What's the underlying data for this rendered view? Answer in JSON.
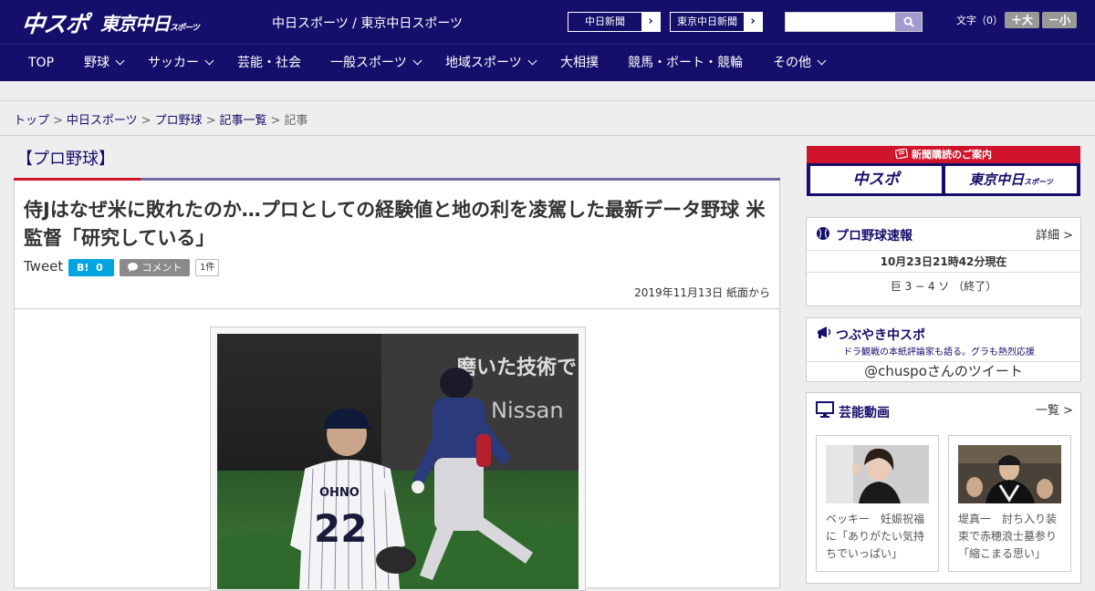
{
  "header": {
    "logo_main": "中スポ",
    "logo_tokyo": "東京中日",
    "logo_tokyo_suffix": "スポーツ",
    "site_name": "中日スポーツ / 東京中日スポーツ",
    "paper_links": [
      "中日新聞",
      "東京中日新聞"
    ],
    "search_placeholder": "",
    "font_size_label": "文字（0）",
    "font_bigger": "＋大",
    "font_smaller": "－小"
  },
  "nav": [
    {
      "label": "TOP",
      "has_menu": false
    },
    {
      "label": "野球",
      "has_menu": true
    },
    {
      "label": "サッカー",
      "has_menu": true
    },
    {
      "label": "芸能・社会",
      "has_menu": false
    },
    {
      "label": "一般スポーツ",
      "has_menu": true
    },
    {
      "label": "地域スポーツ",
      "has_menu": true
    },
    {
      "label": "大相撲",
      "has_menu": false
    },
    {
      "label": "競馬・ボート・競輪",
      "has_menu": false
    },
    {
      "label": "その他",
      "has_menu": true
    }
  ],
  "breadcrumb": [
    "トップ",
    "中日スポーツ",
    "プロ野球",
    "記事一覧",
    "記事"
  ],
  "article": {
    "category": "【プロ野球】",
    "headline": "侍Jはなぜ米に敗れたのか…プロとしての経験値と地の利を凌駕した最新データ野球 米監督「研究している」",
    "tweet_label": "Tweet",
    "hatena_label": "B!",
    "hatena_count": "0",
    "comment_label": "コメント",
    "comment_count": "1件",
    "date": "2019年11月13日 紙面から"
  },
  "photo": {
    "jersey_name": "OHNO",
    "jersey_number": "22",
    "stadium_banner": "磨いた技術で",
    "ad_text": "Nissan"
  },
  "sidebar": {
    "subscribe_band": "新聞購読のご案内",
    "subscribe_chuspo": "中スポ",
    "subscribe_tokyo": "東京中日",
    "subscribe_tokyo_suffix": "スポーツ",
    "baseball_title": "プロ野球速報",
    "baseball_more": "詳細 >",
    "baseball_time": "10月23日21時42分現在",
    "baseball_score": "巨 3 − 4 ソ （終了）",
    "tsubuyaki_title": "つぶやき中スポ",
    "tsubuyaki_sub": "ドラ観戦の本紙評論家も語る。グラも熱烈応援",
    "tsubuyaki_link": "@chuspoさんのツイート",
    "video_title": "芸能動画",
    "video_more": "一覧 >",
    "videos": [
      {
        "caption": "ベッキー　妊娠祝福に「ありがたい気持ちでいっぱい」"
      },
      {
        "caption": "堤真一　討ち入り装束で赤穂浪士墓参り「縮こまる思い」"
      }
    ]
  },
  "colors": {
    "brand_navy": "#150f6b",
    "accent_red": "#d0142b",
    "hatena_blue": "#00a4de"
  }
}
